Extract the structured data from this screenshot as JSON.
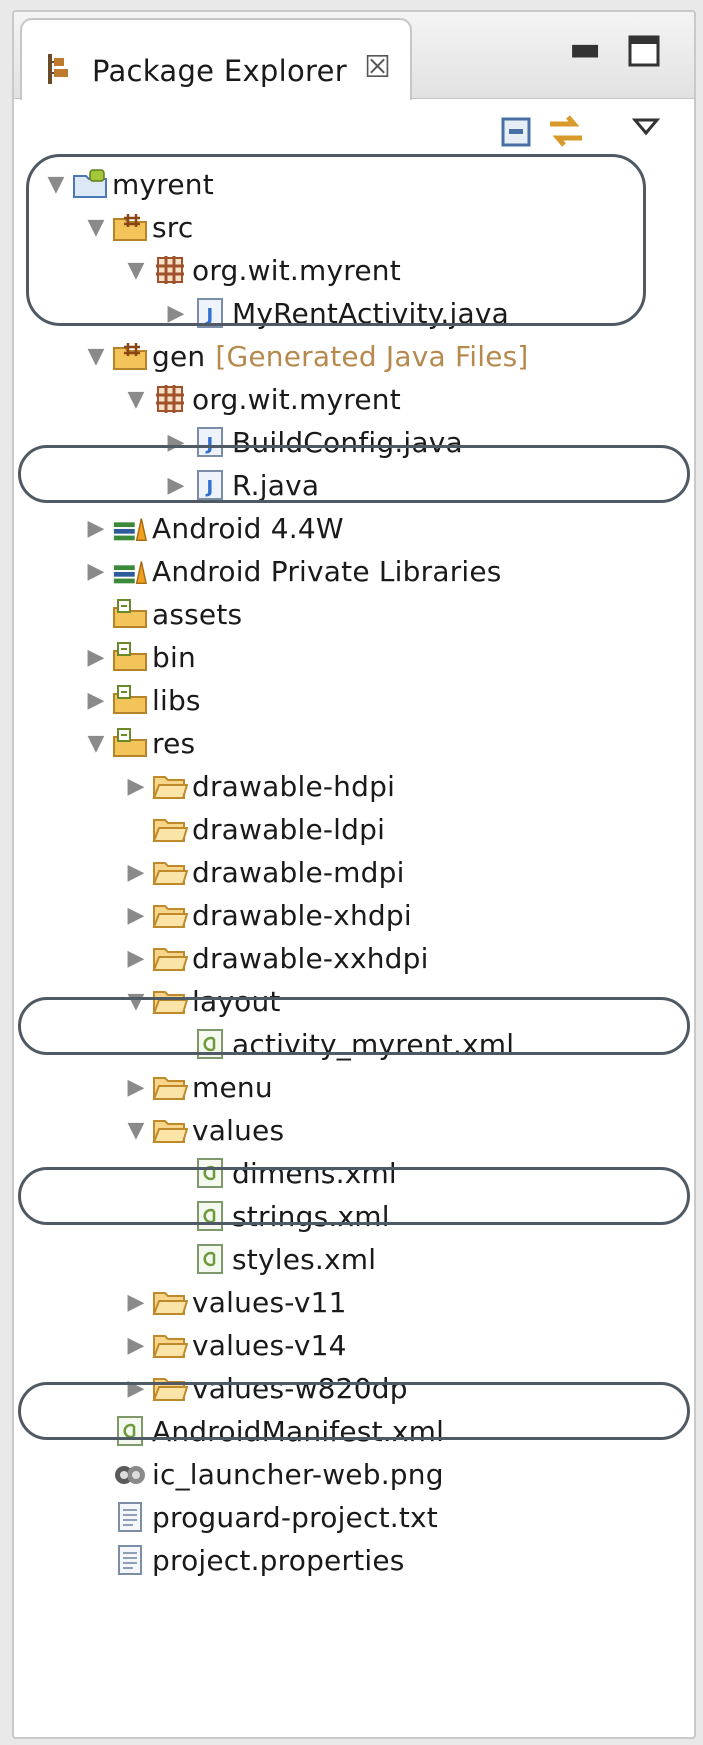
{
  "tab": {
    "title": "Package Explorer"
  },
  "tree": [
    {
      "label": "myrent",
      "suffix": "",
      "icon": "android-project-icon",
      "depth": 0,
      "toggle": "expanded"
    },
    {
      "label": "src",
      "suffix": "",
      "icon": "source-folder-icon",
      "depth": 1,
      "toggle": "expanded"
    },
    {
      "label": "org.wit.myrent",
      "suffix": "",
      "icon": "package-icon",
      "depth": 2,
      "toggle": "expanded"
    },
    {
      "label": "MyRentActivity.java",
      "suffix": "",
      "icon": "java-file-icon",
      "depth": 3,
      "toggle": "collapsed"
    },
    {
      "label": "gen",
      "suffix": "[Generated Java Files]",
      "icon": "source-folder-icon",
      "depth": 1,
      "toggle": "expanded"
    },
    {
      "label": "org.wit.myrent",
      "suffix": "",
      "icon": "package-icon",
      "depth": 2,
      "toggle": "expanded"
    },
    {
      "label": "BuildConfig.java",
      "suffix": "",
      "icon": "java-file-icon",
      "depth": 3,
      "toggle": "collapsed"
    },
    {
      "label": "R.java",
      "suffix": "",
      "icon": "java-file-icon",
      "depth": 3,
      "toggle": "collapsed"
    },
    {
      "label": "Android 4.4W",
      "suffix": "",
      "icon": "library-icon",
      "depth": 1,
      "toggle": "collapsed"
    },
    {
      "label": "Android Private Libraries",
      "suffix": "",
      "icon": "library-icon",
      "depth": 1,
      "toggle": "collapsed"
    },
    {
      "label": "assets",
      "suffix": "",
      "icon": "android-folder-icon",
      "depth": 1,
      "toggle": "none"
    },
    {
      "label": "bin",
      "suffix": "",
      "icon": "android-folder-icon",
      "depth": 1,
      "toggle": "collapsed"
    },
    {
      "label": "libs",
      "suffix": "",
      "icon": "android-folder-icon",
      "depth": 1,
      "toggle": "collapsed"
    },
    {
      "label": "res",
      "suffix": "",
      "icon": "android-folder-icon",
      "depth": 1,
      "toggle": "expanded"
    },
    {
      "label": "drawable-hdpi",
      "suffix": "",
      "icon": "folder-icon",
      "depth": 2,
      "toggle": "collapsed"
    },
    {
      "label": "drawable-ldpi",
      "suffix": "",
      "icon": "folder-icon",
      "depth": 2,
      "toggle": "none"
    },
    {
      "label": "drawable-mdpi",
      "suffix": "",
      "icon": "folder-icon",
      "depth": 2,
      "toggle": "collapsed"
    },
    {
      "label": "drawable-xhdpi",
      "suffix": "",
      "icon": "folder-icon",
      "depth": 2,
      "toggle": "collapsed"
    },
    {
      "label": "drawable-xxhdpi",
      "suffix": "",
      "icon": "folder-icon",
      "depth": 2,
      "toggle": "collapsed"
    },
    {
      "label": "layout",
      "suffix": "",
      "icon": "folder-icon",
      "depth": 2,
      "toggle": "expanded"
    },
    {
      "label": "activity_myrent.xml",
      "suffix": "",
      "icon": "xml-file-icon",
      "depth": 3,
      "toggle": "none"
    },
    {
      "label": "menu",
      "suffix": "",
      "icon": "folder-icon",
      "depth": 2,
      "toggle": "collapsed"
    },
    {
      "label": "values",
      "suffix": "",
      "icon": "folder-icon",
      "depth": 2,
      "toggle": "expanded"
    },
    {
      "label": "dimens.xml",
      "suffix": "",
      "icon": "xml-file-icon",
      "depth": 3,
      "toggle": "none"
    },
    {
      "label": "strings.xml",
      "suffix": "",
      "icon": "xml-file-icon",
      "depth": 3,
      "toggle": "none"
    },
    {
      "label": "styles.xml",
      "suffix": "",
      "icon": "xml-file-icon",
      "depth": 3,
      "toggle": "none"
    },
    {
      "label": "values-v11",
      "suffix": "",
      "icon": "folder-icon",
      "depth": 2,
      "toggle": "collapsed"
    },
    {
      "label": "values-v14",
      "suffix": "",
      "icon": "folder-icon",
      "depth": 2,
      "toggle": "collapsed"
    },
    {
      "label": "values-w820dp",
      "suffix": "",
      "icon": "folder-icon",
      "depth": 2,
      "toggle": "collapsed"
    },
    {
      "label": "AndroidManifest.xml",
      "suffix": "",
      "icon": "xml-file-icon",
      "depth": 1,
      "toggle": "none"
    },
    {
      "label": "ic_launcher-web.png",
      "suffix": "",
      "icon": "image-file-icon",
      "depth": 1,
      "toggle": "none"
    },
    {
      "label": "proguard-project.txt",
      "suffix": "",
      "icon": "text-file-icon",
      "depth": 1,
      "toggle": "none"
    },
    {
      "label": "project.properties",
      "suffix": "",
      "icon": "text-file-icon",
      "depth": 1,
      "toggle": "none"
    }
  ],
  "colors": {
    "highlight_outline": "#505a64",
    "generated_suffix": "#b68a4e",
    "folder": "#e9b84f",
    "package": "#a0522d",
    "java_badge": "#2f6fd0",
    "library": "#3b8a3b"
  }
}
